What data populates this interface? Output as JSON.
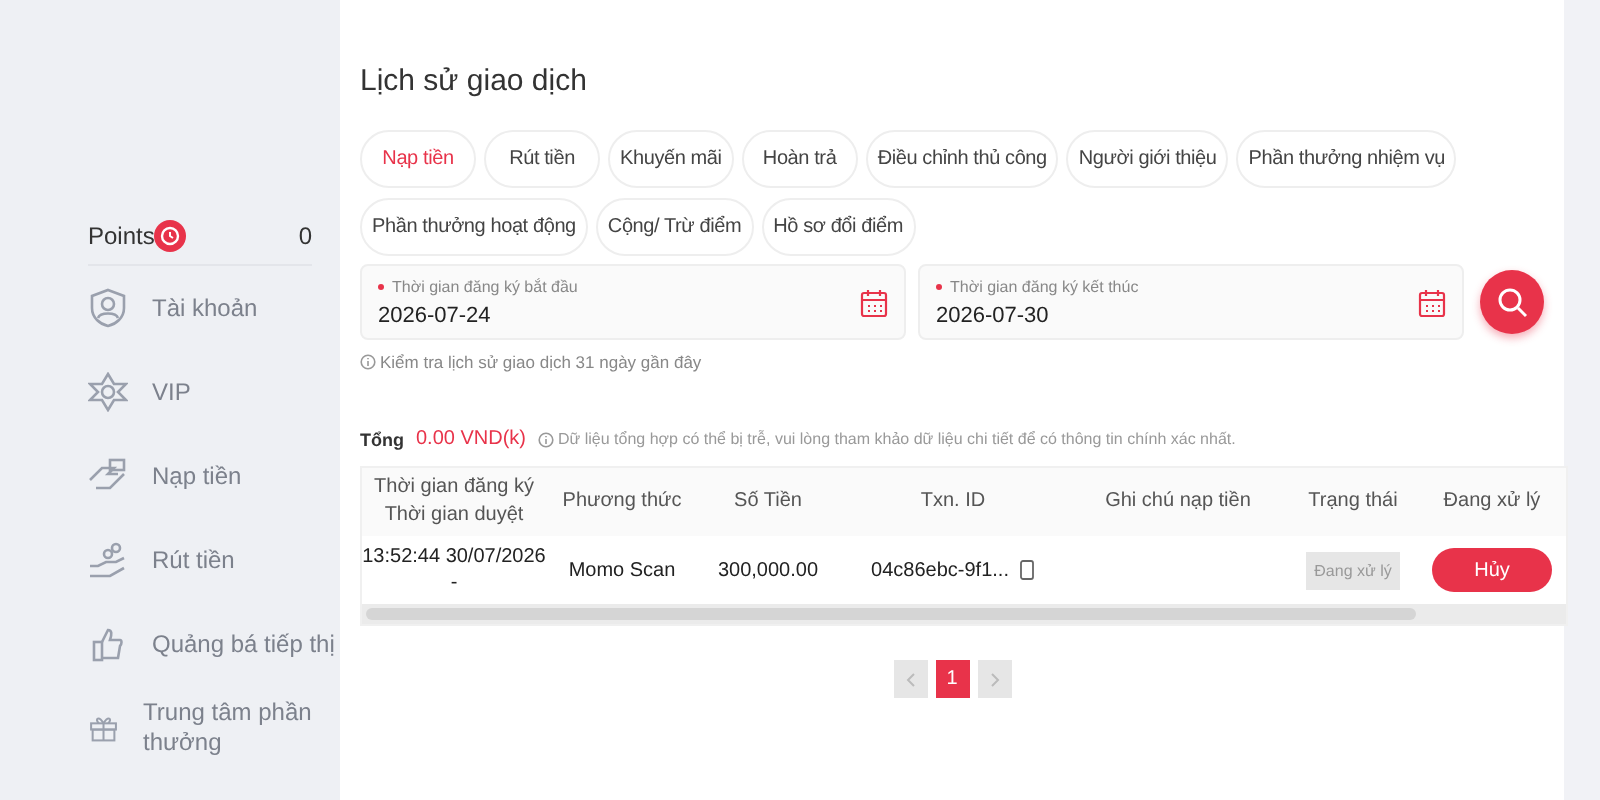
{
  "sidebar": {
    "points": {
      "label": "Points",
      "value": "0"
    },
    "items": [
      {
        "label": "Tài khoản",
        "kind": "account"
      },
      {
        "label": "VIP",
        "kind": "vip"
      },
      {
        "label": "Nạp tiền",
        "kind": "deposit"
      },
      {
        "label": "Rút tiền",
        "kind": "withdraw"
      },
      {
        "label": "Quảng bá tiếp thị",
        "kind": "promote"
      },
      {
        "label": "Trung tâm phần thưởng",
        "kind": "reward"
      }
    ]
  },
  "title": "Lịch sử giao dịch",
  "tabs": [
    {
      "label": "Nạp tiền",
      "selected": true
    },
    {
      "label": "Rút tiền",
      "selected": false
    },
    {
      "label": "Khuyến mãi",
      "selected": false
    },
    {
      "label": "Hoàn trả",
      "selected": false
    },
    {
      "label": "Điều chỉnh thủ công",
      "selected": false
    },
    {
      "label": "Người giới thiệu",
      "selected": false
    },
    {
      "label": "Phần thưởng nhiệm vụ",
      "selected": false
    },
    {
      "label": "Phần thưởng hoạt động",
      "selected": false
    },
    {
      "label": "Cộng/ Trừ điểm",
      "selected": false
    },
    {
      "label": "Hồ sơ đổi điểm",
      "selected": false
    }
  ],
  "date_fields": [
    {
      "label": "Thời gian đăng ký bắt đầu",
      "value": "2026-07-24"
    },
    {
      "label": "Thời gian đăng ký kết thúc",
      "value": "2026-07-30"
    }
  ],
  "hint": "Kiểm tra lịch sử giao dịch 31 ngày gần đây",
  "total": {
    "label": "Tổng",
    "value": "0.00 VND(k)",
    "note": "Dữ liệu tổng hợp có thể bị trễ, vui lòng tham khảo dữ liệu chi tiết để có thông tin chính xác nhất."
  },
  "table": {
    "columns": [
      [
        "Thời gian đăng ký",
        "Thời gian duyệt"
      ],
      [
        "Phương thức"
      ],
      [
        "Số Tiền"
      ],
      [
        "Txn. ID"
      ],
      [
        "Ghi chú nạp tiền"
      ],
      [
        "Trạng thái"
      ],
      [
        "Đang xử lý"
      ]
    ],
    "rows": [
      {
        "time": [
          "13:52:44 30/07/2026",
          "-"
        ],
        "method": "Momo Scan",
        "amount": "300,000.00",
        "txn_id": "04c86ebc-9f1...",
        "note": "",
        "status": "Đang xử lý",
        "action": "Hủy"
      }
    ]
  },
  "pagination": {
    "pages": [
      {
        "label": "1",
        "selected": true
      }
    ]
  }
}
